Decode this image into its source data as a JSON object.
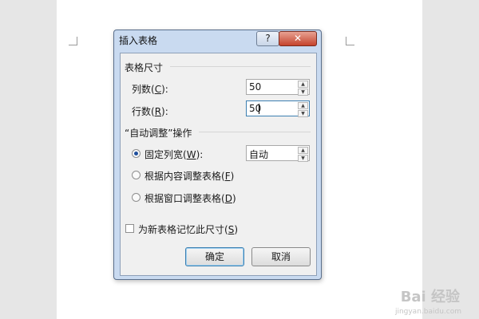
{
  "dialog": {
    "title": "插入表格",
    "help_glyph": "?",
    "close_glyph": "✕"
  },
  "table_size": {
    "group_label": "表格尺寸",
    "columns": {
      "label": "列数(",
      "key": "C",
      "suffix": "):",
      "value": "50"
    },
    "rows": {
      "label": "行数(",
      "key": "R",
      "suffix": "):",
      "value": "50"
    }
  },
  "autofit": {
    "group_label": "“自动调整”操作",
    "options": [
      {
        "label": "固定列宽(",
        "key": "W",
        "suffix": "):",
        "checked": true
      },
      {
        "label": "根据内容调整表格(",
        "key": "F",
        "suffix": ")",
        "checked": false
      },
      {
        "label": "根据窗口调整表格(",
        "key": "D",
        "suffix": ")",
        "checked": false
      }
    ],
    "fixed_width_value": "自动"
  },
  "remember": {
    "label": "为新表格记忆此尺寸(",
    "key": "S",
    "suffix": ")",
    "checked": false
  },
  "buttons": {
    "ok": "确定",
    "cancel": "取消"
  },
  "watermark": {
    "brand": "Bai 经验",
    "url": "jingyan.baidu.com"
  }
}
